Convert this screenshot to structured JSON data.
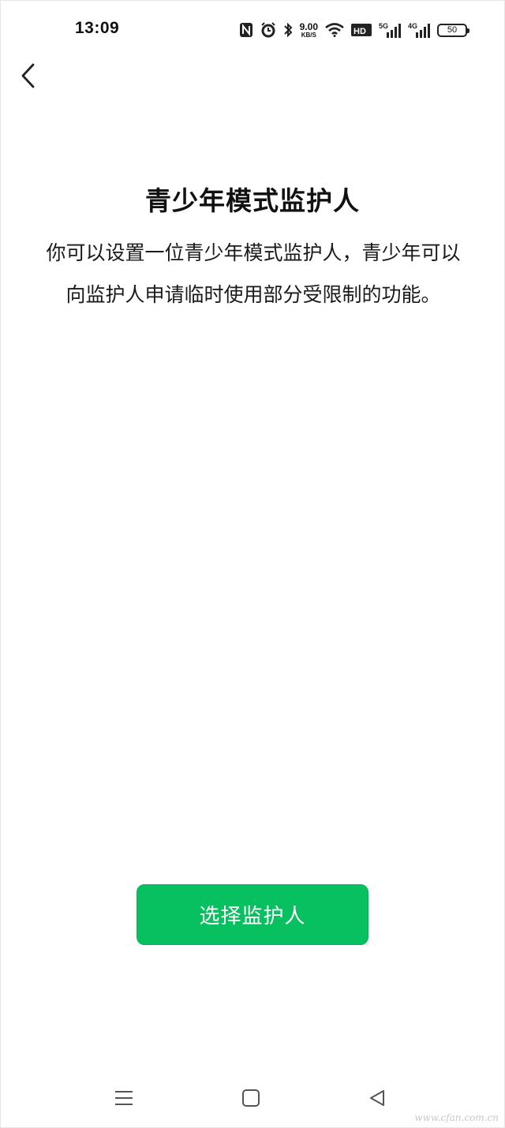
{
  "status_bar": {
    "time": "13:09",
    "net_speed_value": "9.00",
    "net_speed_unit": "KB/S",
    "hd_label": "HD",
    "signal1_label": "5G",
    "signal2_label": "4G",
    "battery_level": "50",
    "icons": [
      "nfc-icon",
      "alarm-icon",
      "bluetooth-icon",
      "wifi-icon",
      "hd-icon",
      "signal-5g-icon",
      "signal-4g-icon",
      "battery-icon"
    ]
  },
  "header": {
    "back_icon": "chevron-left-icon"
  },
  "main": {
    "title": "青少年模式监护人",
    "description": "你可以设置一位青少年模式监护人，青少年可以向监护人申请临时使用部分受限制的功能。"
  },
  "action": {
    "select_label": "选择监护人",
    "accent_color": "#07c160"
  },
  "nav_bar": {
    "icons": [
      "menu-icon",
      "home-icon",
      "back-triangle-icon"
    ]
  },
  "watermark": "www.cfan.com.cn"
}
